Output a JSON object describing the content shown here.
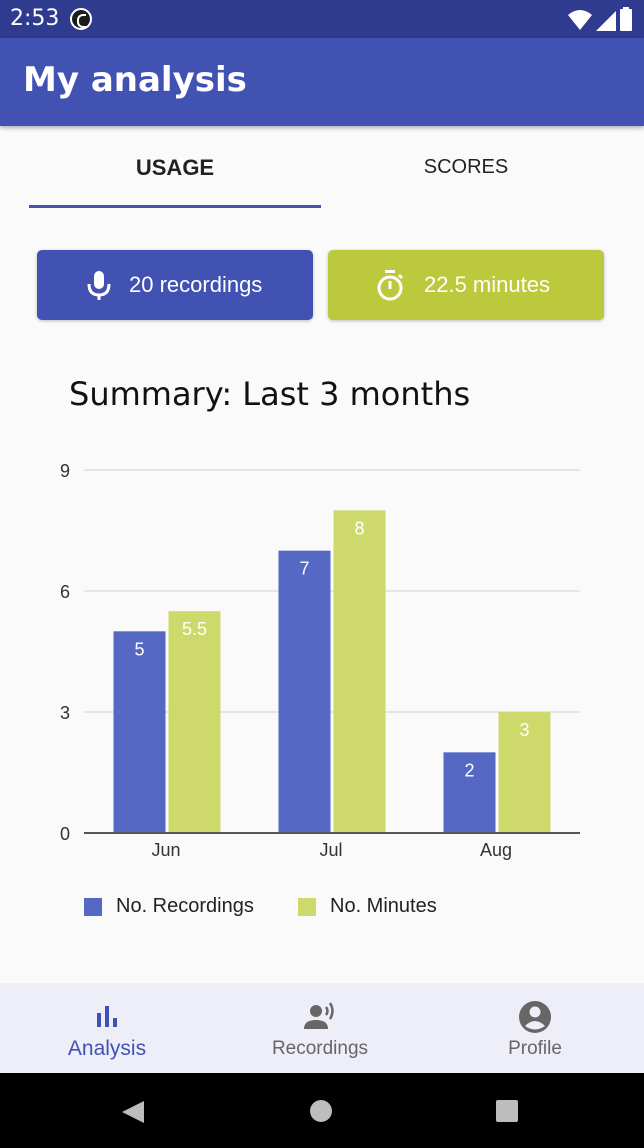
{
  "status_bar": {
    "time": "2:53"
  },
  "app_bar": {
    "title": "My analysis"
  },
  "tabs": [
    {
      "label": "USAGE",
      "active": true
    },
    {
      "label": "SCORES",
      "active": false
    }
  ],
  "summary": {
    "recordings_label": "20 recordings",
    "minutes_label": "22.5 minutes"
  },
  "chart_title": "Summary: Last 3 months",
  "chart_data": {
    "type": "bar",
    "categories": [
      "Jun",
      "Jul",
      "Aug"
    ],
    "series": [
      {
        "name": "No. Recordings",
        "values": [
          5,
          7,
          2
        ],
        "color": "#5468c4"
      },
      {
        "name": "No. Minutes",
        "values": [
          5.5,
          8,
          3
        ],
        "color": "#cdd96b"
      }
    ],
    "data_labels": [
      [
        "5",
        "7",
        "2"
      ],
      [
        "5.5",
        "8",
        "3"
      ]
    ],
    "y_ticks": [
      "0",
      "3",
      "6",
      "9"
    ],
    "ylim": [
      0,
      9
    ],
    "grid": true,
    "legend": "bottom"
  },
  "bottom_nav": [
    {
      "label": "Analysis",
      "icon": "bar-chart-icon",
      "active": true
    },
    {
      "label": "Recordings",
      "icon": "voice-recording-icon",
      "active": false
    },
    {
      "label": "Profile",
      "icon": "account-circle-icon",
      "active": false
    }
  ],
  "colors": {
    "primary": "#4152b3",
    "accent": "#bcc93d",
    "status_bar": "#2f3b8f"
  }
}
